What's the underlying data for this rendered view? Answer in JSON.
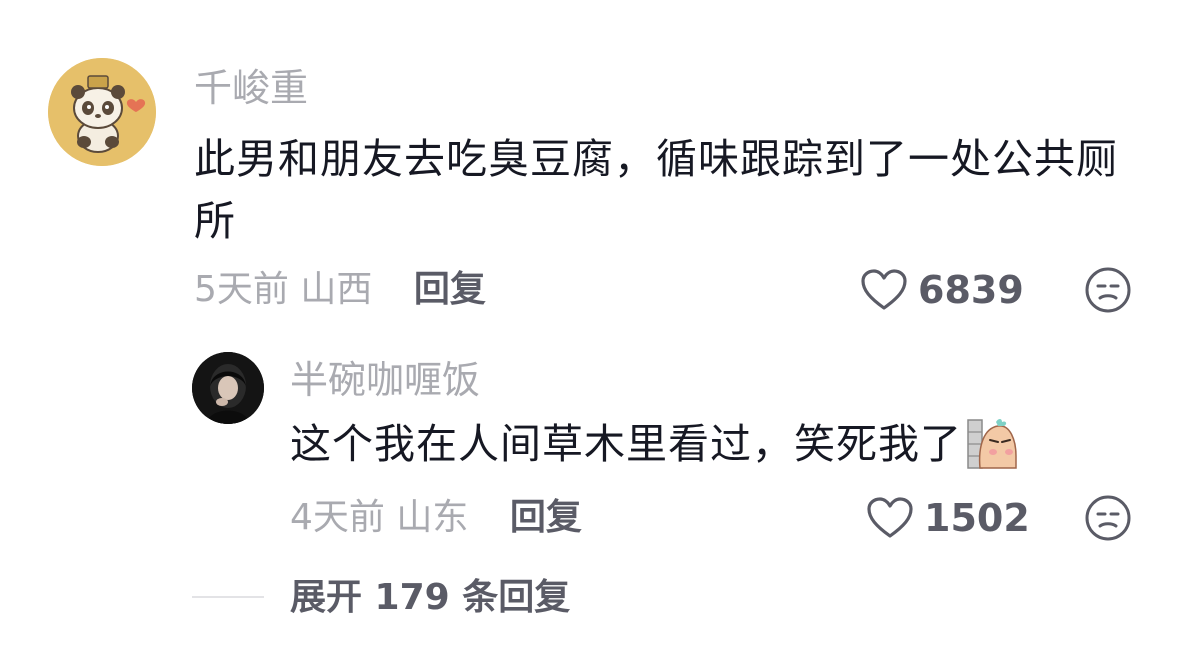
{
  "comment": {
    "username": "千峻重",
    "text": "此男和朋友去吃臭豆腐，循味跟踪到了一处公共厕所",
    "time": "5天前",
    "location": "山西",
    "reply_label": "回复",
    "like_count": "6839",
    "avatar_icon": "panda-avatar-icon"
  },
  "reply": {
    "username": "半碗咖喱饭",
    "text": "这个我在人间草木里看过，笑死我了",
    "time": "4天前",
    "location": "山东",
    "reply_label": "回复",
    "like_count": "1502",
    "sticker_icon": "peeking-sticker-icon"
  },
  "expand": {
    "label": "展开 179 条回复"
  },
  "colors": {
    "primary_text": "#161823",
    "secondary_text": "#a9aab0",
    "action_text": "#5a5b66"
  }
}
